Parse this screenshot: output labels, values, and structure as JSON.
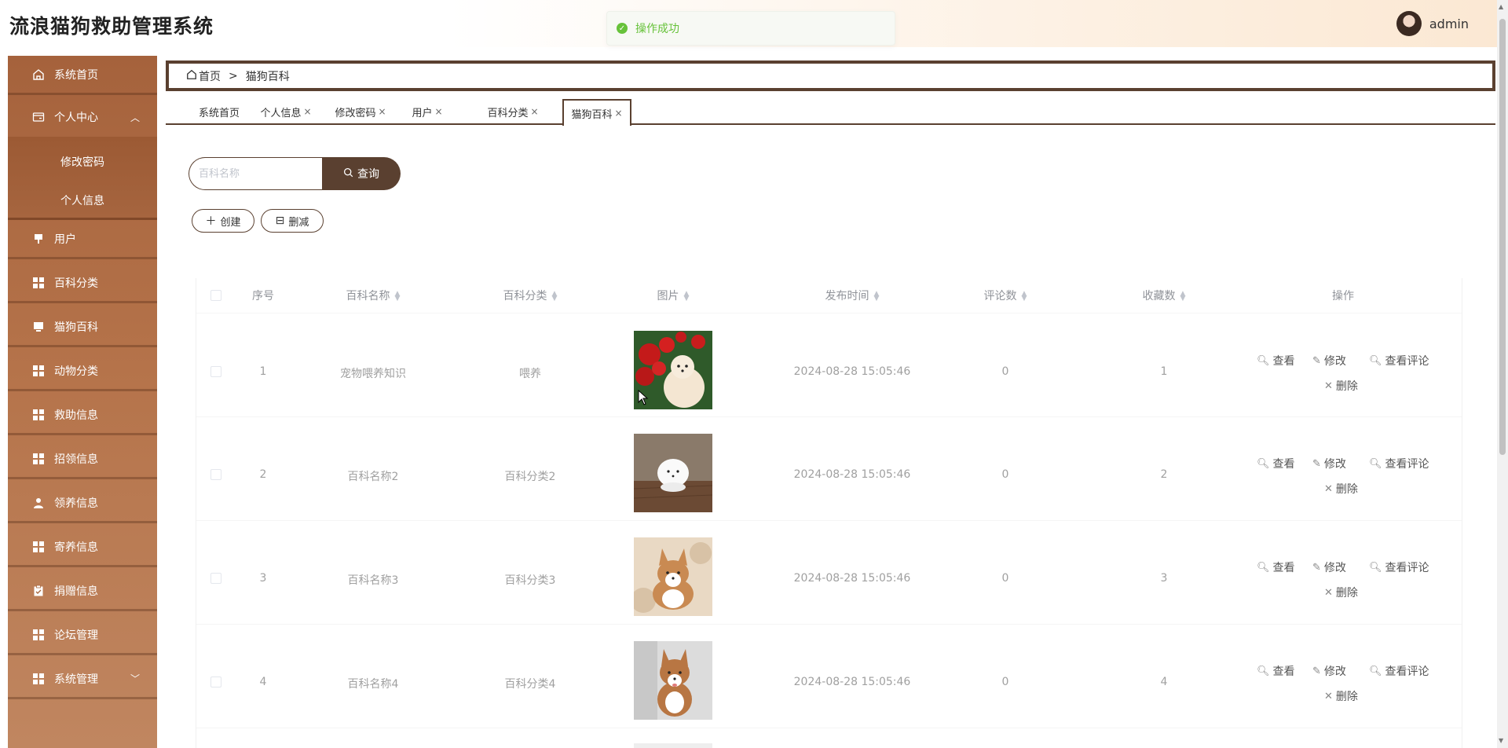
{
  "header": {
    "title": "流浪猫狗救助管理系统",
    "toast": "操作成功",
    "username": "admin"
  },
  "sidebar": {
    "items": [
      {
        "label": "系统首页",
        "icon": "home-icon"
      },
      {
        "label": "个人中心",
        "icon": "wallet-icon"
      },
      {
        "label": "用户",
        "icon": "pin-icon"
      },
      {
        "label": "百科分类",
        "icon": "grid-icon"
      },
      {
        "label": "猫狗百科",
        "icon": "monitor-icon"
      },
      {
        "label": "动物分类",
        "icon": "grid-icon"
      },
      {
        "label": "救助信息",
        "icon": "grid-icon"
      },
      {
        "label": "招领信息",
        "icon": "grid-icon"
      },
      {
        "label": "领养信息",
        "icon": "user-icon"
      },
      {
        "label": "寄养信息",
        "icon": "grid-icon"
      },
      {
        "label": "捐赠信息",
        "icon": "clipboard-icon"
      },
      {
        "label": "论坛管理",
        "icon": "grid-icon"
      },
      {
        "label": "系统管理",
        "icon": "grid-icon"
      }
    ],
    "sub_items": [
      {
        "label": "修改密码"
      },
      {
        "label": "个人信息"
      }
    ]
  },
  "breadcrumb": {
    "home": "首页",
    "separator": ">",
    "current": "猫狗百科"
  },
  "tabs": [
    {
      "label": "系统首页"
    },
    {
      "label": "个人信息"
    },
    {
      "label": "修改密码"
    },
    {
      "label": "用户"
    },
    {
      "label": "百科分类"
    },
    {
      "label": "猫狗百科"
    }
  ],
  "search": {
    "placeholder": "百科名称",
    "button": "查询"
  },
  "actions": {
    "create": "创建",
    "delete": "删减"
  },
  "table": {
    "headers": {
      "index": "序号",
      "name": "百科名称",
      "category": "百科分类",
      "image": "图片",
      "time": "发布时间",
      "comments": "评论数",
      "favorites": "收藏数",
      "ops": "操作"
    },
    "row_actions": {
      "view": "查看",
      "edit": "修改",
      "comments": "查看评论",
      "delete": "删除"
    },
    "rows": [
      {
        "index": "1",
        "name": "宠物喂养知识",
        "category": "喂养",
        "time": "2024-08-28 15:05:46",
        "comments": "0",
        "favorites": "1"
      },
      {
        "index": "2",
        "name": "百科名称2",
        "category": "百科分类2",
        "time": "2024-08-28 15:05:46",
        "comments": "0",
        "favorites": "2"
      },
      {
        "index": "3",
        "name": "百科名称3",
        "category": "百科分类3",
        "time": "2024-08-28 15:05:46",
        "comments": "0",
        "favorites": "3"
      },
      {
        "index": "4",
        "name": "百科名称4",
        "category": "百科分类4",
        "time": "2024-08-28 15:05:46",
        "comments": "0",
        "favorites": "4"
      }
    ]
  }
}
